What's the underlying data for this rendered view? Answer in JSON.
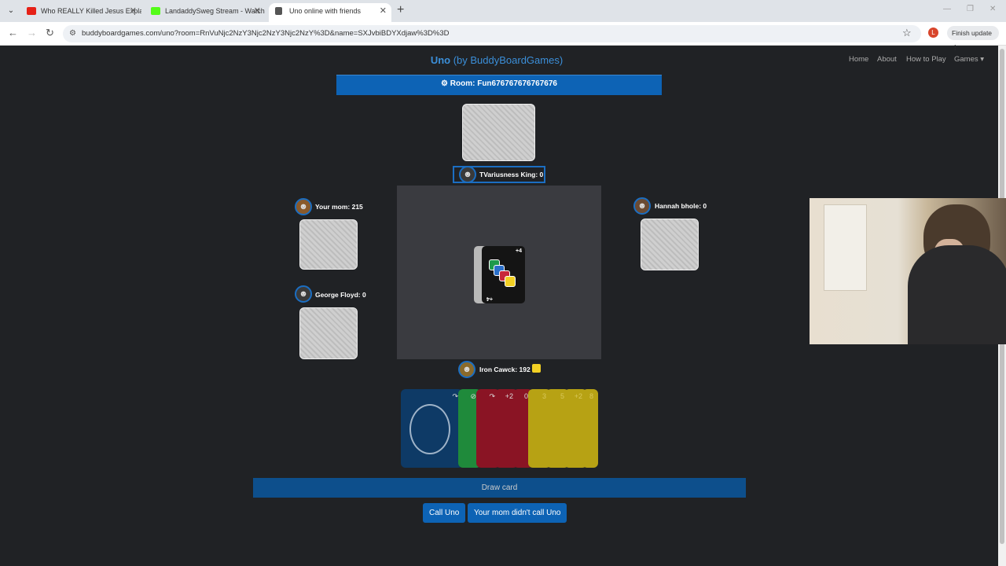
{
  "browser": {
    "tabs": [
      {
        "title": "Who REALLY Killed Jesus Explai"
      },
      {
        "title": "LandaddySweg Stream - Watch"
      },
      {
        "title": "Uno online with friends"
      }
    ],
    "url": "buddyboardgames.com/uno?room=RnVuNjc2NzY3Njc2NzY3Njc2NzY%3D&name=SXJvbiBDYXdjaw%3D%3D",
    "profile_initial": "L",
    "finish_update": "Finish update"
  },
  "site": {
    "brand_bold": "Uno",
    "brand_rest": " (by BuddyBoardGames)",
    "nav": [
      "Home",
      "About",
      "How to Play",
      "Games"
    ],
    "room_label": "Room: Fun676767676767676"
  },
  "players": {
    "top": "TVariusness King: 0",
    "left1": "Your mom: 215",
    "left2": "George Floyd: 0",
    "right": "Hannah bhole: 0",
    "me": "Iron Cawck: 192"
  },
  "discard": {
    "corner_top": "+4",
    "corner_bottom": "+4"
  },
  "hand": [
    {
      "color": "#0e3a66",
      "label": "↷"
    },
    {
      "color": "#1f8a3b",
      "label": "⊘"
    },
    {
      "color": "#8a1424",
      "label": "↷"
    },
    {
      "color": "#8a1424",
      "label": "+2"
    },
    {
      "color": "#8a1424",
      "label": "0"
    },
    {
      "color": "#b7a214",
      "label": "3"
    },
    {
      "color": "#b7a214",
      "label": "5"
    },
    {
      "color": "#b7a214",
      "label": "+2"
    },
    {
      "color": "#b7a214",
      "label": "8"
    }
  ],
  "actions": {
    "draw": "Draw card",
    "call_uno": "Call Uno",
    "didnt_call": "Your mom didn't call Uno"
  },
  "colors": {
    "accent": "#0d63b5",
    "current_color": "#f2d024"
  }
}
